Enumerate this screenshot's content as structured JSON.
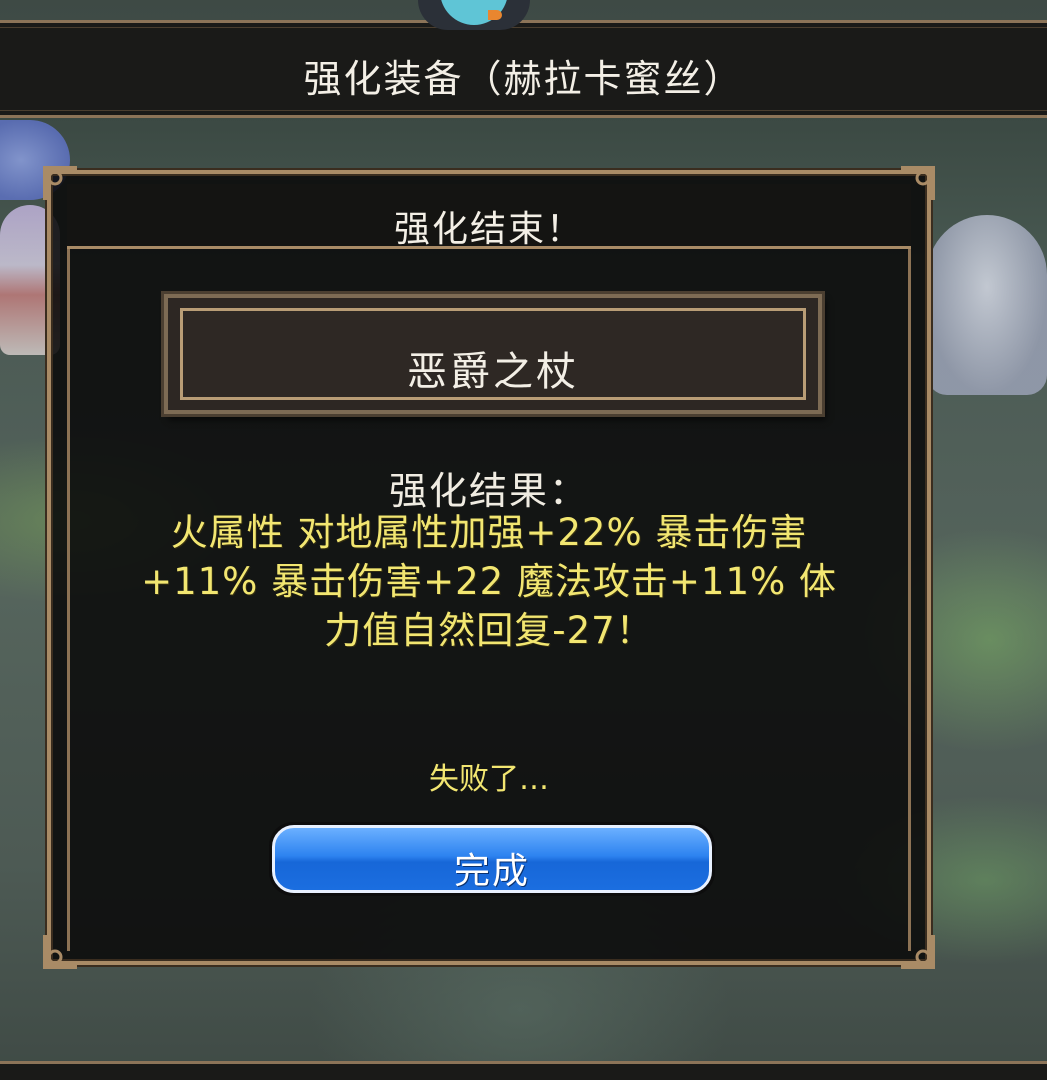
{
  "window": {
    "title": "强化装备（赫拉卡蜜丝）"
  },
  "dialog": {
    "title": "强化结束！",
    "item_name": "恶爵之杖",
    "result_heading": "强化结果：",
    "result_lines": [
      "火属性 对地属性加强+22% 暴击伤害",
      "+11% 暴击伤害+22 魔法攻击+11% 体",
      "力值自然回复-27！"
    ],
    "status": "失败了…",
    "done_button_label": "完成"
  },
  "colors": {
    "frame": "#a98b66",
    "result_text": "#f2e671",
    "button": "#2d83f0"
  },
  "icons": {
    "mascot": "mascot-icon",
    "corner_ornament": "corner-ornament-icon"
  }
}
